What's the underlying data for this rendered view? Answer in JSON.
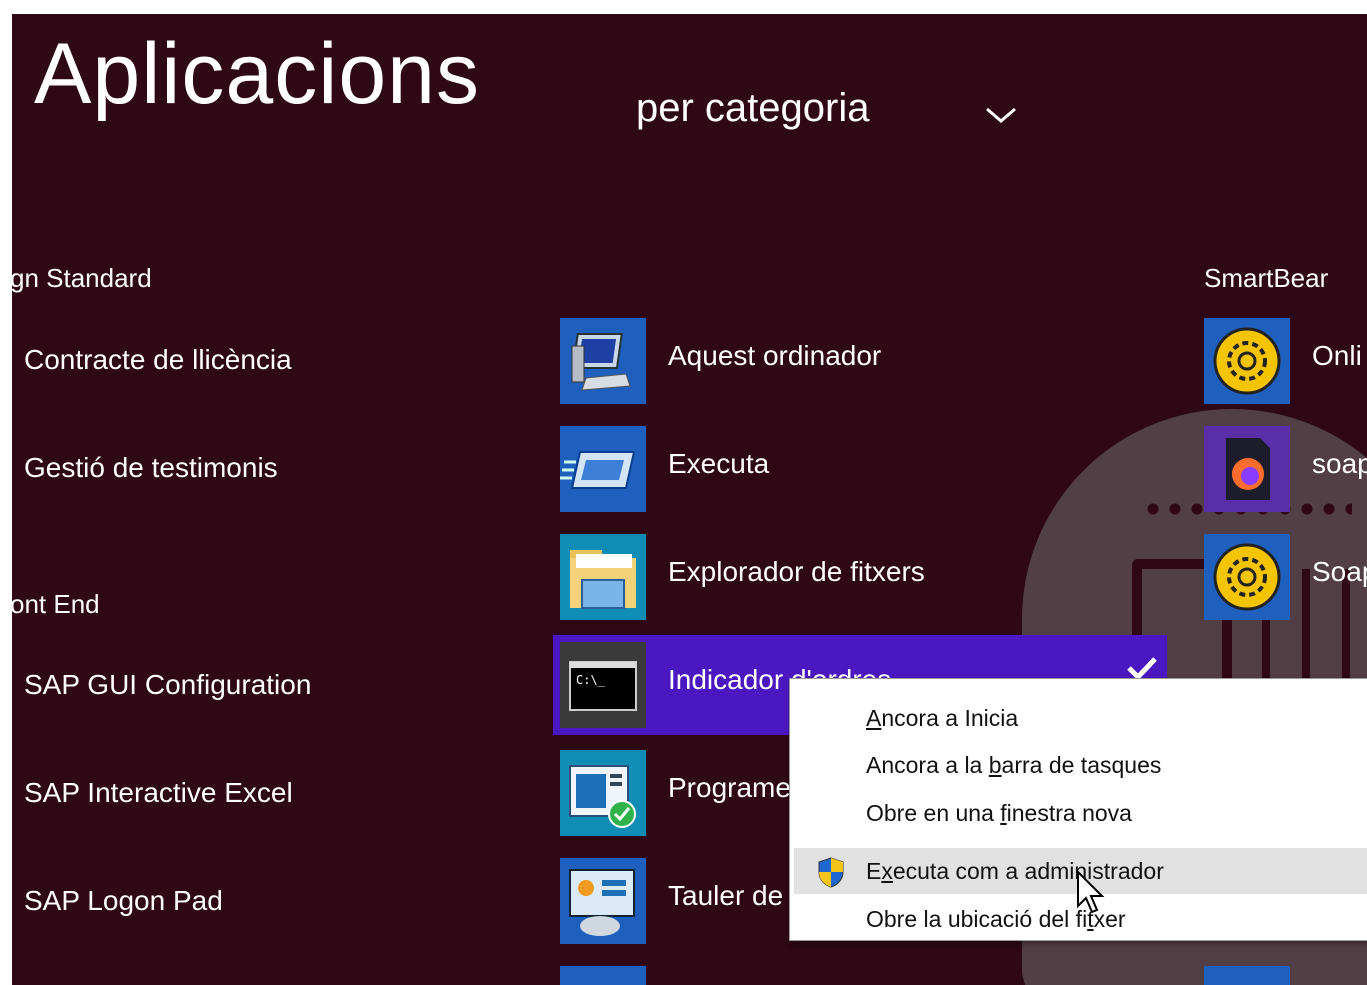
{
  "header": {
    "title": "Aplicacions",
    "subtitle": "per categoria"
  },
  "groups": {
    "left_top": {
      "header": "gn Standard",
      "items": [
        "Contracte de llicència",
        "Gestió de testimonis"
      ]
    },
    "left_bottom": {
      "header": "ont End",
      "items": [
        "SAP GUI Configuration",
        "SAP Interactive Excel",
        "SAP Logon Pad"
      ]
    },
    "middle": {
      "items": [
        {
          "label": "Aquest ordinador",
          "icon": "computer-icon"
        },
        {
          "label": "Executa",
          "icon": "run-icon"
        },
        {
          "label": "Explorador de fitxers",
          "icon": "folder-icon"
        },
        {
          "label": "Indicador d'ordres",
          "icon": "command-prompt-icon"
        },
        {
          "label": "Programe",
          "icon": "default-programs-icon"
        },
        {
          "label": "Tauler de",
          "icon": "control-panel-icon"
        }
      ]
    },
    "right": {
      "header": "SmartBear",
      "items": [
        {
          "label": "Onli",
          "icon": "soapui-gear-icon"
        },
        {
          "label": "soap",
          "icon": "firefox-file-icon"
        },
        {
          "label": "Soap",
          "icon": "soapui-gear-icon"
        }
      ]
    }
  },
  "context_menu": {
    "items": [
      {
        "prefix": "",
        "ul": "A",
        "rest": "ncora a Inicia"
      },
      {
        "prefix": "Ancora a la ",
        "ul": "b",
        "rest": "arra de tasques"
      },
      {
        "prefix": "Obre en una ",
        "ul": "f",
        "rest": "inestra nova"
      },
      {
        "prefix": "E",
        "ul": "x",
        "rest": "ecuta com a administrador"
      },
      {
        "prefix": "Obre la ubicació del fi",
        "ul": "t",
        "rest": "xer"
      }
    ]
  },
  "colors": {
    "background": "#2e0814",
    "selection": "#4b17c0",
    "tile_blue": "#1f5fbd",
    "soapui_yellow": "#f5c400"
  }
}
